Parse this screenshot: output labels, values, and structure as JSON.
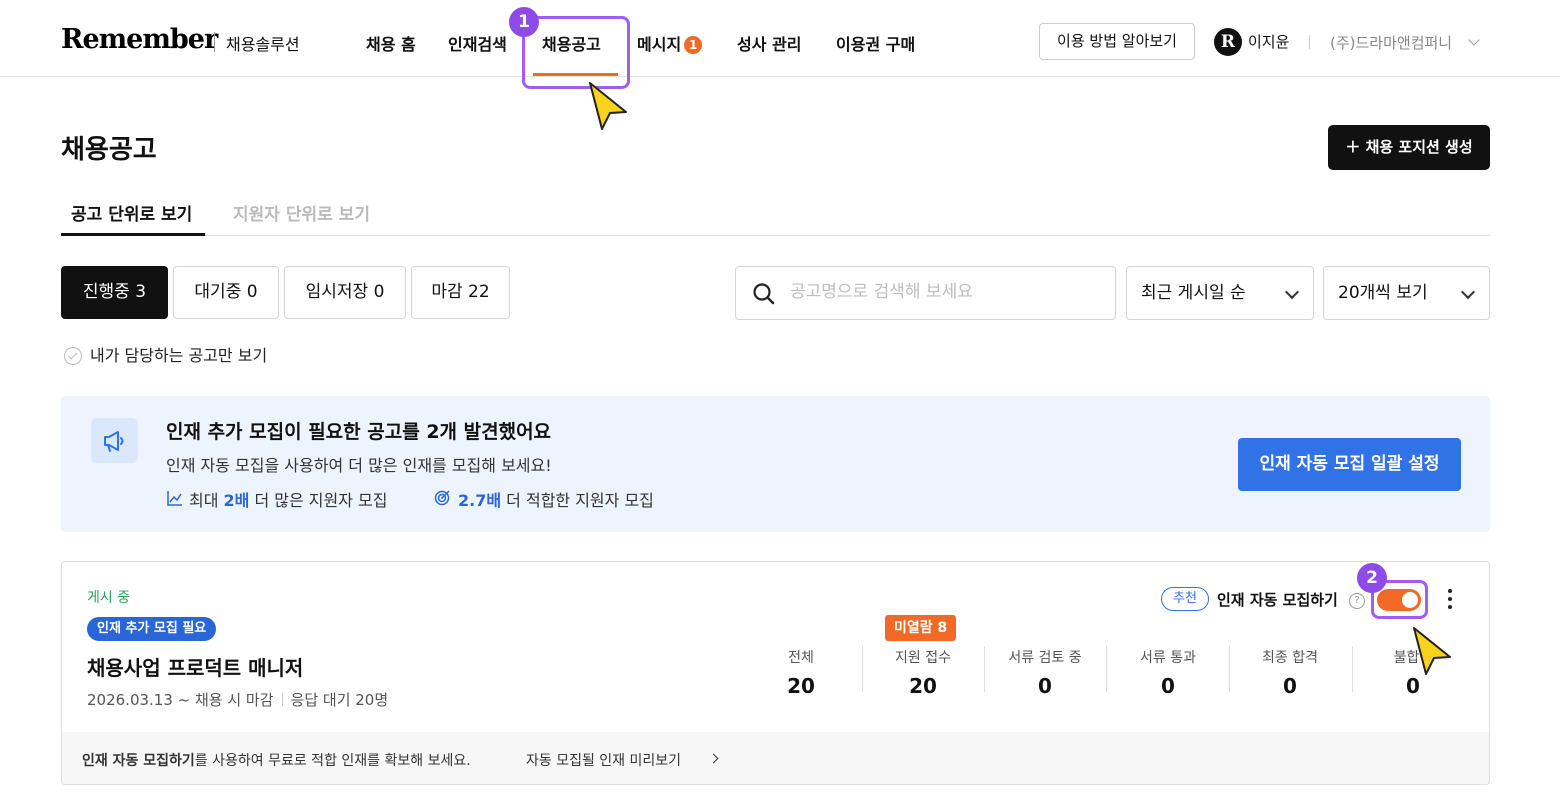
{
  "header": {
    "logo": "Remember",
    "logo_sub": "채용솔루션",
    "nav": [
      {
        "label": "채용 홈"
      },
      {
        "label": "인재검색"
      },
      {
        "label": "채용공고"
      },
      {
        "label": "메시지",
        "badge": "1"
      },
      {
        "label": "성사 관리"
      },
      {
        "label": "이용권 구매"
      }
    ],
    "help_button": "이용 방법 알아보기",
    "avatar_letter": "R",
    "user_name": "이지윤",
    "company": "(주)드라마앤컴퍼니"
  },
  "steps": [
    "1",
    "2"
  ],
  "page": {
    "title": "채용공고",
    "create_button": "＋ 채용 포지션 생성",
    "tabs": [
      "공고 단위로 보기",
      "지원자 단위로 보기"
    ],
    "filters": [
      {
        "label": "진행중 3"
      },
      {
        "label": "대기중 0"
      },
      {
        "label": "임시저장 0"
      },
      {
        "label": "마감 22"
      }
    ],
    "search_placeholder": "공고명으로 검색해 보세요",
    "sort_select": "최근 게시일 순",
    "page_size_select": "20개씩 보기",
    "my_only_label": "내가 담당하는 공고만 보기"
  },
  "banner": {
    "title": "인재 추가 모집이 필요한 공고를 2개 발견했어요",
    "subtitle": "인재 자동 모집을 사용하여 더 많은 인재를 모집해 보세요!",
    "stat1_pre": "최대 ",
    "stat1_value": "2배",
    "stat1_post": " 더 많은 지원자 모집",
    "stat2_value": "2.7배",
    "stat2_post": " 더 적합한 지원자 모집",
    "button": "인재 자동 모집 일괄 설정"
  },
  "job": {
    "status": "게시 중",
    "tag": "인재 추가 모집 필요",
    "title": "채용사업 프로덕트 매니저",
    "date": "2026.03.13 ~ 채용 시 마감",
    "waiting": "응답 대기 20명",
    "recommend": "추천",
    "auto_label": "인재 자동 모집하기",
    "help_icon": "?",
    "unread_badge": "미열람 8",
    "stats": [
      {
        "label": "전체",
        "value": "20"
      },
      {
        "label": "지원 접수",
        "value": "20"
      },
      {
        "label": "서류 검토 중",
        "value": "0"
      },
      {
        "label": "서류 통과",
        "value": "0"
      },
      {
        "label": "최종 합격",
        "value": "0"
      },
      {
        "label": "불합격",
        "value": "0"
      }
    ],
    "footer_bold": "인재 자동 모집하기",
    "footer_text": "를 사용하여 무료로 적합 인재를 확보해 보세요.",
    "footer_link": "자동 모집될 인재 미리보기"
  },
  "colors": {
    "accent": "#f06a25",
    "blue": "#3172e6",
    "highlight": "#a45cf0",
    "cursor": "#f7d31e"
  }
}
